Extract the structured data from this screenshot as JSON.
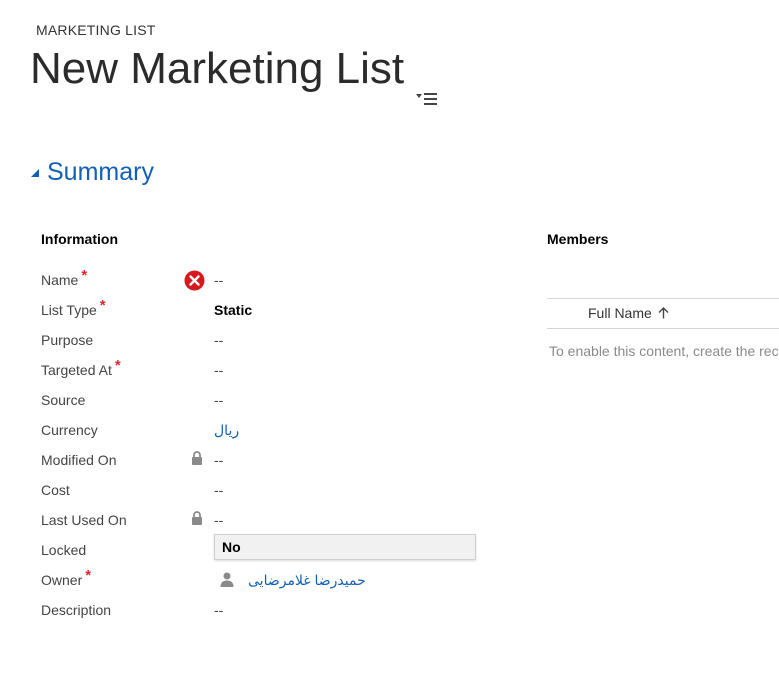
{
  "header": {
    "entity_label": "MARKETING LIST",
    "record_title": "New Marketing List"
  },
  "section": {
    "title": "Summary"
  },
  "information": {
    "title": "Information",
    "fields": {
      "name": {
        "label": "Name",
        "value": "--"
      },
      "list_type": {
        "label": "List Type",
        "value": "Static"
      },
      "purpose": {
        "label": "Purpose",
        "value": "--"
      },
      "targeted_at": {
        "label": "Targeted At",
        "value": "--"
      },
      "source": {
        "label": "Source",
        "value": "--"
      },
      "currency": {
        "label": "Currency",
        "value": "ریال"
      },
      "modified_on": {
        "label": "Modified On",
        "value": "--"
      },
      "cost": {
        "label": "Cost",
        "value": "--"
      },
      "last_used_on": {
        "label": "Last Used On",
        "value": "--"
      },
      "locked": {
        "label": "Locked",
        "value": "No"
      },
      "owner": {
        "label": "Owner",
        "value": "حمیدرضا غلامرضایی"
      },
      "description": {
        "label": "Description",
        "value": "--"
      }
    },
    "required_marker": "*"
  },
  "members": {
    "title": "Members",
    "column_full_name": "Full Name",
    "message": "To enable this content, create the record."
  },
  "colors": {
    "accent": "#1160b7",
    "required": "#e0252b",
    "error": "#d7191f"
  }
}
